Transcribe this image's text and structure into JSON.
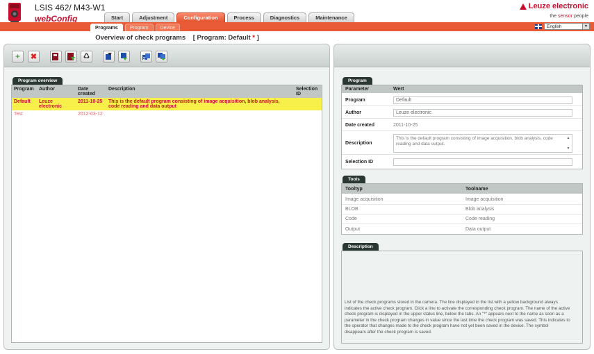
{
  "header": {
    "product_title": "LSIS 462/ M43-W1",
    "app_name": "webConfig",
    "brand_name": "Leuze electronic",
    "slogan_prefix": "the ",
    "slogan_highlight": "sensor",
    "slogan_suffix": " people",
    "brand_color": "#c8102e",
    "camera_icon": "camera-icon"
  },
  "main_tabs": [
    {
      "label": "Start",
      "active": false
    },
    {
      "label": "Adjustment",
      "active": false
    },
    {
      "label": "Configuration",
      "active": true
    },
    {
      "label": "Process",
      "active": false
    },
    {
      "label": "Diagnostics",
      "active": false
    },
    {
      "label": "Maintenance",
      "active": false
    }
  ],
  "sub_tabs": [
    {
      "label": "Programs",
      "active": true
    },
    {
      "label": "Program",
      "active": false
    },
    {
      "label": "Device",
      "active": false
    }
  ],
  "language": {
    "selected": "English",
    "flag_icon": "uk-flag-icon"
  },
  "page": {
    "title": "Overview of check programs",
    "program_prefix": "[ Program: Default",
    "modified_marker": "*",
    "program_suffix": "]"
  },
  "toolbar": {
    "buttons": [
      {
        "name": "new-program-button",
        "icon": "plus-icon"
      },
      {
        "name": "delete-program-button",
        "icon": "delete-icon"
      },
      {
        "name": "save-program-button",
        "icon": "save-icon"
      },
      {
        "name": "save-as-program-button",
        "icon": "save-as-icon"
      },
      {
        "name": "recycle-button",
        "icon": "recycle-icon"
      },
      {
        "name": "upload-button",
        "icon": "upload-icon"
      },
      {
        "name": "download-button",
        "icon": "download-icon"
      },
      {
        "name": "upload-all-button",
        "icon": "upload-all-icon"
      },
      {
        "name": "download-all-button",
        "icon": "download-all-icon"
      }
    ]
  },
  "program_overview": {
    "tab_label": "Program overview",
    "columns": [
      "Program",
      "Author",
      "Date created",
      "Description",
      "Selection ID"
    ],
    "rows": [
      {
        "program": "Default",
        "author": "Leuze electronic",
        "date": "2011-10-25",
        "description": "This is the default program consisting of image acquisition, blob analysis, code reading and data output",
        "selection_id": "",
        "active": true
      },
      {
        "program": "Test",
        "author": "",
        "date": "2012-03-12",
        "description": "",
        "selection_id": "",
        "active": false
      }
    ]
  },
  "program_details": {
    "tab_label": "Program",
    "col_parameter": "Parameter",
    "col_value": "Wert",
    "fields": {
      "program_label": "Program",
      "program_value": "Default",
      "author_label": "Author",
      "author_value": "Leuze electronic",
      "date_label": "Date created",
      "date_value": "2011-10-25",
      "description_label": "Description",
      "description_value": "This is the default program consisting of image acquisition, blob analysis, code reading and data output.",
      "selection_label": "Selection ID",
      "selection_value": ""
    }
  },
  "tools": {
    "tab_label": "Tools",
    "col_tooltyp": "Tooltyp",
    "col_toolname": "Toolname",
    "rows": [
      {
        "type": "Image acquisition",
        "name": "Image acquisition"
      },
      {
        "type": "BLOB",
        "name": "Blob analysis"
      },
      {
        "type": "Code",
        "name": "Code reading"
      },
      {
        "type": "Output",
        "name": "Data output"
      }
    ]
  },
  "description": {
    "tab_label": "Description",
    "text": "List of the check programs stored in the camera. The line displayed in the list with a yellow background always indicates the active check program. Click a line to activate the corresponding check program. The name of the active check program is displayed in the upper status line, below the tabs. An \"*\" appears next to the name as soon as a parameter in the check program changes in value since the last time the check program was saved. This indicates to the operator that changes made to the check program have not yet been saved in the device. The symbol disappears after the check program is saved."
  }
}
